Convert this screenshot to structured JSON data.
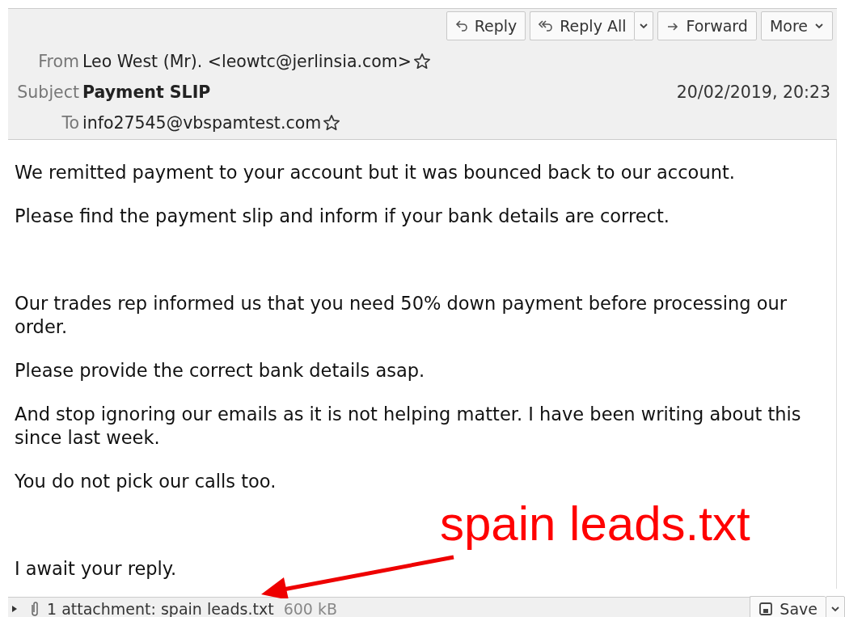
{
  "toolbar": {
    "buttons": [
      {
        "label": "Reply",
        "kind": "reply"
      },
      {
        "label": "Reply All",
        "kind": "reply-all"
      },
      {
        "label": "Forward",
        "kind": "forward"
      },
      {
        "label": "More",
        "kind": "more"
      }
    ]
  },
  "header": {
    "from_label": "From",
    "from": "Leo West (Mr). <leowtc@jerlinsia.com>",
    "subject_label": "Subject",
    "subject": "Payment SLIP",
    "date": "20/02/2019, 20:23",
    "to_label": "To",
    "to": "info27545@vbspamtest.com"
  },
  "body": [
    {
      "kind": "text",
      "text": "We remitted payment to your account but it was bounced back to our account."
    },
    {
      "kind": "text",
      "text": "Please find the payment slip and inform if your bank details are correct."
    },
    {
      "kind": "blank"
    },
    {
      "kind": "text",
      "text": "Our trades rep informed us that you need 50% down payment before processing our order."
    },
    {
      "kind": "text",
      "text": "Please provide the correct bank details asap."
    },
    {
      "kind": "text",
      "text": "And stop ignoring our emails as it is not helping matter. I have been writing about this since last week."
    },
    {
      "kind": "text",
      "text": "You do not pick our calls too."
    },
    {
      "kind": "blank"
    },
    {
      "kind": "text",
      "text": "I await your reply."
    }
  ],
  "annotation": {
    "text": "spain leads.txt"
  },
  "attachment_bar": {
    "expanded": false,
    "summary": "1 attachment: spain leads.txt",
    "size": "600 kB",
    "save": "Save"
  }
}
